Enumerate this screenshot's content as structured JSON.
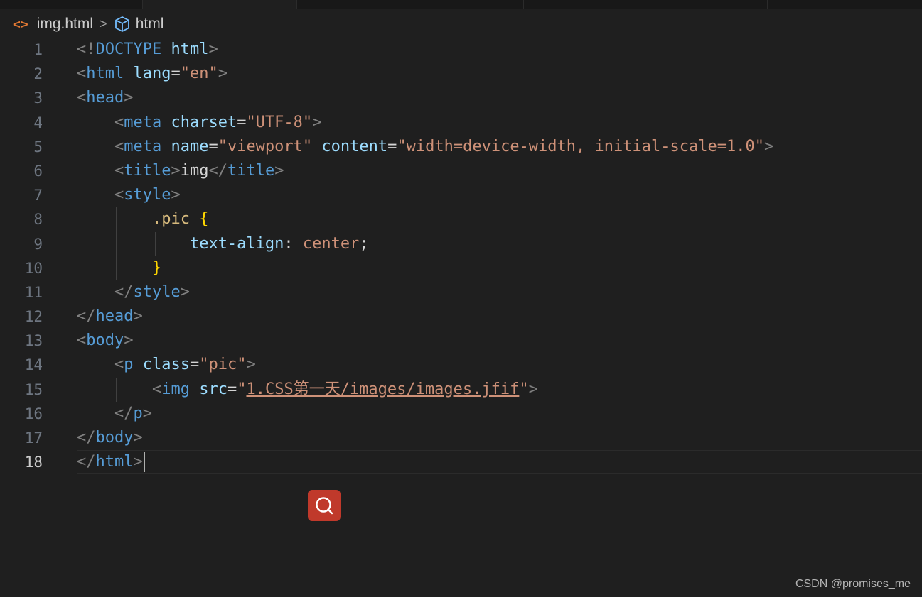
{
  "breadcrumb": {
    "file_icon": "<>",
    "file_name": "img.html",
    "separator": ">",
    "symbol_name": "html"
  },
  "editor": {
    "current_line": "18",
    "lines": [
      {
        "n": "1",
        "tokens": [
          [
            "bracket",
            "<!"
          ],
          [
            "tag",
            "DOCTYPE"
          ],
          [
            "text",
            " "
          ],
          [
            "attr",
            "html"
          ],
          [
            "bracket",
            ">"
          ]
        ]
      },
      {
        "n": "2",
        "tokens": [
          [
            "bracket",
            "<"
          ],
          [
            "tag",
            "html"
          ],
          [
            "text",
            " "
          ],
          [
            "attr",
            "lang"
          ],
          [
            "text",
            "="
          ],
          [
            "str",
            "\"en\""
          ],
          [
            "bracket",
            ">"
          ]
        ]
      },
      {
        "n": "3",
        "tokens": [
          [
            "bracket",
            "<"
          ],
          [
            "tag",
            "head"
          ],
          [
            "bracket",
            ">"
          ]
        ]
      },
      {
        "n": "4",
        "tokens": [
          [
            "text",
            "    "
          ],
          [
            "bracket",
            "<"
          ],
          [
            "tag",
            "meta"
          ],
          [
            "text",
            " "
          ],
          [
            "attr",
            "charset"
          ],
          [
            "text",
            "="
          ],
          [
            "str",
            "\"UTF-8\""
          ],
          [
            "bracket",
            ">"
          ]
        ]
      },
      {
        "n": "5",
        "tokens": [
          [
            "text",
            "    "
          ],
          [
            "bracket",
            "<"
          ],
          [
            "tag",
            "meta"
          ],
          [
            "text",
            " "
          ],
          [
            "attr",
            "name"
          ],
          [
            "text",
            "="
          ],
          [
            "str",
            "\"viewport\""
          ],
          [
            "text",
            " "
          ],
          [
            "attr",
            "content"
          ],
          [
            "text",
            "="
          ],
          [
            "str",
            "\"width=device-width, initial-scale=1.0\""
          ],
          [
            "bracket",
            ">"
          ]
        ]
      },
      {
        "n": "6",
        "tokens": [
          [
            "text",
            "    "
          ],
          [
            "bracket",
            "<"
          ],
          [
            "tag",
            "title"
          ],
          [
            "bracket",
            ">"
          ],
          [
            "text",
            "img"
          ],
          [
            "bracket",
            "</"
          ],
          [
            "tag",
            "title"
          ],
          [
            "bracket",
            ">"
          ]
        ]
      },
      {
        "n": "7",
        "tokens": [
          [
            "text",
            "    "
          ],
          [
            "bracket",
            "<"
          ],
          [
            "tag",
            "style"
          ],
          [
            "bracket",
            ">"
          ]
        ]
      },
      {
        "n": "8",
        "tokens": [
          [
            "text",
            "        "
          ],
          [
            "sel",
            ".pic"
          ],
          [
            "text",
            " "
          ],
          [
            "brace",
            "{"
          ]
        ]
      },
      {
        "n": "9",
        "tokens": [
          [
            "text",
            "            "
          ],
          [
            "prop",
            "text-align"
          ],
          [
            "text",
            ": "
          ],
          [
            "str",
            "center"
          ],
          [
            "text",
            ";"
          ]
        ]
      },
      {
        "n": "10",
        "tokens": [
          [
            "text",
            "        "
          ],
          [
            "brace",
            "}"
          ]
        ]
      },
      {
        "n": "11",
        "tokens": [
          [
            "text",
            "    "
          ],
          [
            "bracket",
            "</"
          ],
          [
            "tag",
            "style"
          ],
          [
            "bracket",
            ">"
          ]
        ]
      },
      {
        "n": "12",
        "tokens": [
          [
            "bracket",
            "</"
          ],
          [
            "tag",
            "head"
          ],
          [
            "bracket",
            ">"
          ]
        ]
      },
      {
        "n": "13",
        "tokens": [
          [
            "bracket",
            "<"
          ],
          [
            "tag",
            "body"
          ],
          [
            "bracket",
            ">"
          ]
        ]
      },
      {
        "n": "14",
        "tokens": [
          [
            "text",
            "    "
          ],
          [
            "bracket",
            "<"
          ],
          [
            "tag",
            "p"
          ],
          [
            "text",
            " "
          ],
          [
            "attr",
            "class"
          ],
          [
            "text",
            "="
          ],
          [
            "str",
            "\"pic\""
          ],
          [
            "bracket",
            ">"
          ]
        ]
      },
      {
        "n": "15",
        "tokens": [
          [
            "text",
            "        "
          ],
          [
            "bracket",
            "<"
          ],
          [
            "tag",
            "img"
          ],
          [
            "text",
            " "
          ],
          [
            "attr",
            "src"
          ],
          [
            "text",
            "="
          ],
          [
            "str",
            "\""
          ],
          [
            "link",
            "1.CSS第一天/images/images.jfif"
          ],
          [
            "str",
            "\""
          ],
          [
            "bracket",
            ">"
          ]
        ]
      },
      {
        "n": "16",
        "tokens": [
          [
            "text",
            "    "
          ],
          [
            "bracket",
            "</"
          ],
          [
            "tag",
            "p"
          ],
          [
            "bracket",
            ">"
          ]
        ]
      },
      {
        "n": "17",
        "tokens": [
          [
            "bracket",
            "</"
          ],
          [
            "tag",
            "body"
          ],
          [
            "bracket",
            ">"
          ]
        ]
      },
      {
        "n": "18",
        "tokens": [
          [
            "bracket",
            "</"
          ],
          [
            "tag",
            "html"
          ],
          [
            "bracket",
            ">"
          ]
        ]
      }
    ]
  },
  "floating_button": {
    "icon": "search-icon",
    "color": "#c0392b"
  },
  "watermark": {
    "text": "CSDN @promises_me"
  },
  "colors": {
    "background": "#1f1f1f",
    "tag": "#569cd6",
    "attribute": "#9cdcfe",
    "string": "#ce9178",
    "bracket": "#808080",
    "selector": "#d7ba7d",
    "brace": "#ffd700"
  }
}
